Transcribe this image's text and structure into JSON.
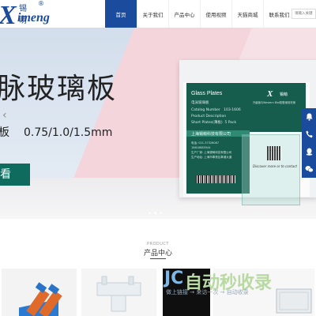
{
  "header": {
    "logo": {
      "mark": "X",
      "cn": "锡萌",
      "en": "imeng",
      "reg": "®"
    },
    "nav": [
      {
        "label": "首页",
        "active": true
      },
      {
        "label": "关于我们",
        "active": false
      },
      {
        "label": "产品中心",
        "active": false
      },
      {
        "label": "使用视频",
        "active": false
      },
      {
        "label": "天猫商城",
        "active": false
      },
      {
        "label": "联系我们",
        "active": false
      }
    ],
    "search_placeholder": "请输入关键"
  },
  "banner": {
    "title": "脉玻璃板",
    "sub_left": "板",
    "sub_spec": "0.75/1.0/1.5mm",
    "button": "看",
    "arrow_left": "‹",
    "product_label": {
      "title": "Glass Plates",
      "subtitle": "电泳玻璃板",
      "catalog_label": "Catalog Number",
      "catalog_value": "103-1606",
      "desc_label": "Product Description",
      "desc_value_a": "Short Plates(薄板)",
      "desc_value_b": "5 Pack",
      "company": "上海锡萌科技有限公司",
      "tel": "电话: 021-37326087",
      "phone": "18616685544",
      "address1": "生产厂家: 上海锡萌科技有限公司",
      "address2": "生产地址: 上海市奉贤区奉浦大道"
    },
    "brand_label": {
      "mark": "X",
      "cn": "锡萌",
      "line": "升级版与Western Blot配套使用完美"
    },
    "qr_caption": "Discover more or to contact"
  },
  "side_bar": {
    "icons": [
      "bell-icon",
      "phone-icon",
      "qq-icon",
      "weixin-icon"
    ]
  },
  "slider": {
    "dots": 3
  },
  "products": {
    "section_en": "PRODUCT",
    "section_title": "产品中心"
  },
  "watermark": {
    "jc": "JC",
    "logo": "自动秒收录",
    "sub": "做上链接 → 来访一次 → 自动收录"
  },
  "colors": {
    "brand": "#1a4b9c",
    "label_green": "#175d4e",
    "button_green": "#0f6b5d"
  }
}
